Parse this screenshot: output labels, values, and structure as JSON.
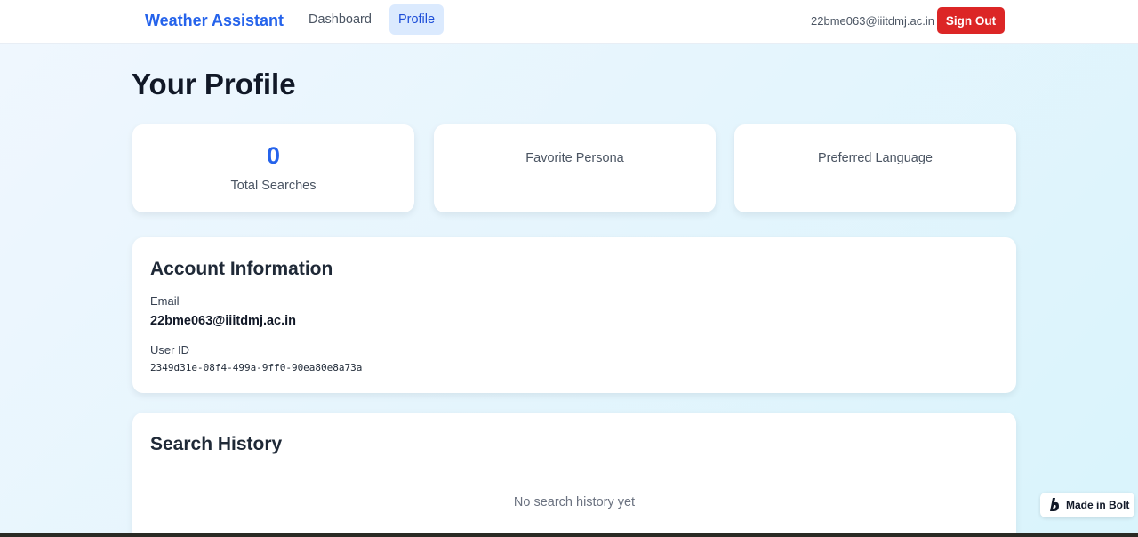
{
  "header": {
    "brand": "Weather Assistant",
    "nav": [
      {
        "label": "Dashboard",
        "active": false
      },
      {
        "label": "Profile",
        "active": true
      }
    ],
    "user_email": "22bme063@iiitdmj.ac.in",
    "signout_label": "Sign Out"
  },
  "page": {
    "title": "Your Profile"
  },
  "stats": [
    {
      "value": "0",
      "label": "Total Searches"
    },
    {
      "value": "",
      "label": "Favorite Persona"
    },
    {
      "value": "",
      "label": "Preferred Language"
    }
  ],
  "account": {
    "title": "Account Information",
    "email_label": "Email",
    "email_value": "22bme063@iiitdmj.ac.in",
    "userid_label": "User ID",
    "userid_value": "2349d31e-08f4-499a-9ff0-90ea80e8a73a"
  },
  "history": {
    "title": "Search History",
    "empty_text": "No search history yet"
  },
  "badge": {
    "label": "Made in Bolt",
    "icon": "bolt-logo-icon"
  },
  "colors": {
    "accent": "#2563eb",
    "danger": "#dc2626",
    "active_nav_bg": "#dbeafe"
  }
}
